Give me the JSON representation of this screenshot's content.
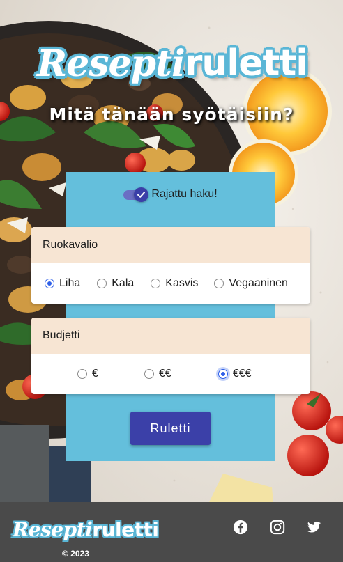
{
  "app": {
    "logo_part1": "Resepti",
    "logo_part2": "ruletti",
    "tagline": "Mitä tänään syötäisiin?"
  },
  "filter": {
    "switch_label": "Rajattu haku!",
    "switch_on": true
  },
  "food": {
    "heading": "Ruokavalio",
    "options": [
      "Liha",
      "Kala",
      "Kasvis",
      "Vegaaninen"
    ],
    "selected": "Liha"
  },
  "budget": {
    "heading": "Budjetti",
    "options": [
      "€",
      "€€",
      "€€€"
    ],
    "selected": "€€€"
  },
  "actions": {
    "roulette_label": "Ruletti"
  },
  "footer": {
    "logo_part1": "Resepti",
    "logo_part2": "ruletti",
    "copyright": "© 2023",
    "social": [
      "facebook-icon",
      "instagram-icon",
      "twitter-icon"
    ]
  },
  "colors": {
    "panel": "#64bfdc",
    "card_header": "#f7e5d3",
    "primary_button": "#3b40a8",
    "radio_selected": "#3060e8",
    "footer": "#4a4a4a"
  }
}
